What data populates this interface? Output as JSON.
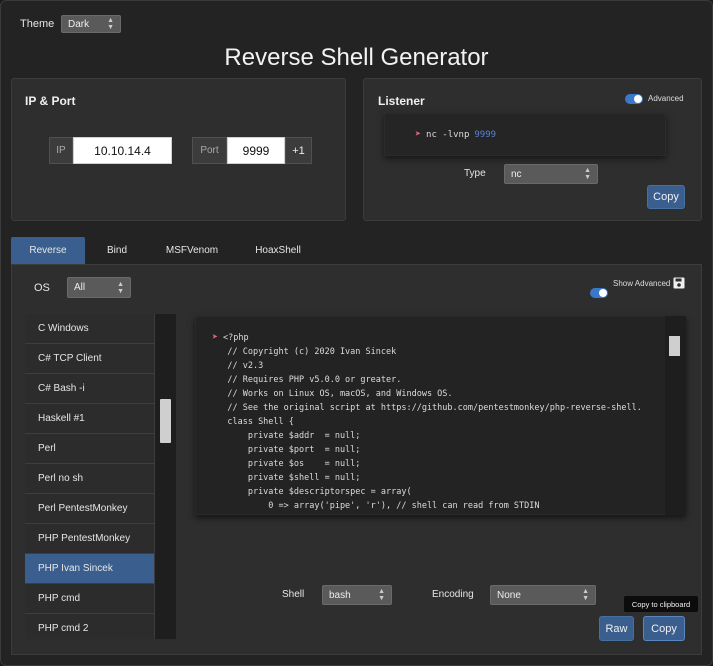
{
  "theme": {
    "label": "Theme",
    "value": "Dark"
  },
  "title": "Reverse Shell Generator",
  "ip_port": {
    "title": "IP & Port",
    "ip_label": "IP",
    "ip_value": "10.10.14.4",
    "port_label": "Port",
    "port_value": "9999",
    "increment_label": "+1"
  },
  "listener": {
    "title": "Listener",
    "advanced_label": "Advanced",
    "command": "nc -lvnp",
    "port": "9999",
    "type_label": "Type",
    "type_value": "nc",
    "copy_label": "Copy"
  },
  "tabs": [
    "Reverse",
    "Bind",
    "MSFVenom",
    "HoaxShell"
  ],
  "os": {
    "label": "OS",
    "value": "All"
  },
  "show_advanced_label": "Show Advanced",
  "shell_list": [
    "C Windows",
    "C# TCP Client",
    "C# Bash -i",
    "Haskell #1",
    "Perl",
    "Perl no sh",
    "Perl PentestMonkey",
    "PHP PentestMonkey",
    "PHP Ivan Sincek",
    "PHP cmd",
    "PHP cmd 2"
  ],
  "selected_shell": "PHP Ivan Sincek",
  "code_lines": [
    "<?php",
    "// Copyright (c) 2020 Ivan Sincek",
    "// v2.3",
    "// Requires PHP v5.0.0 or greater.",
    "// Works on Linux OS, macOS, and Windows OS.",
    "// See the original script at https://github.com/pentestmonkey/php-reverse-shell.",
    "class Shell {",
    "    private $addr  = null;",
    "    private $port  = null;",
    "    private $os    = null;",
    "    private $shell = null;",
    "    private $descriptorspec = array(",
    "        0 => array('pipe', 'r'), // shell can read from STDIN"
  ],
  "shell": {
    "label": "Shell",
    "value": "bash"
  },
  "encoding": {
    "label": "Encoding",
    "value": "None"
  },
  "raw_label": "Raw",
  "copy_label": "Copy",
  "tooltip": "Copy to clipboard",
  "colors": {
    "accent": "#3a5f8f",
    "toggle": "#3a79c9",
    "port_highlight": "#5b7fd8",
    "rocket": "#e86a7d"
  },
  "icons": {
    "rocket": "rocket-icon",
    "save": "save-icon",
    "dropdown": "chevron-down-icon"
  }
}
